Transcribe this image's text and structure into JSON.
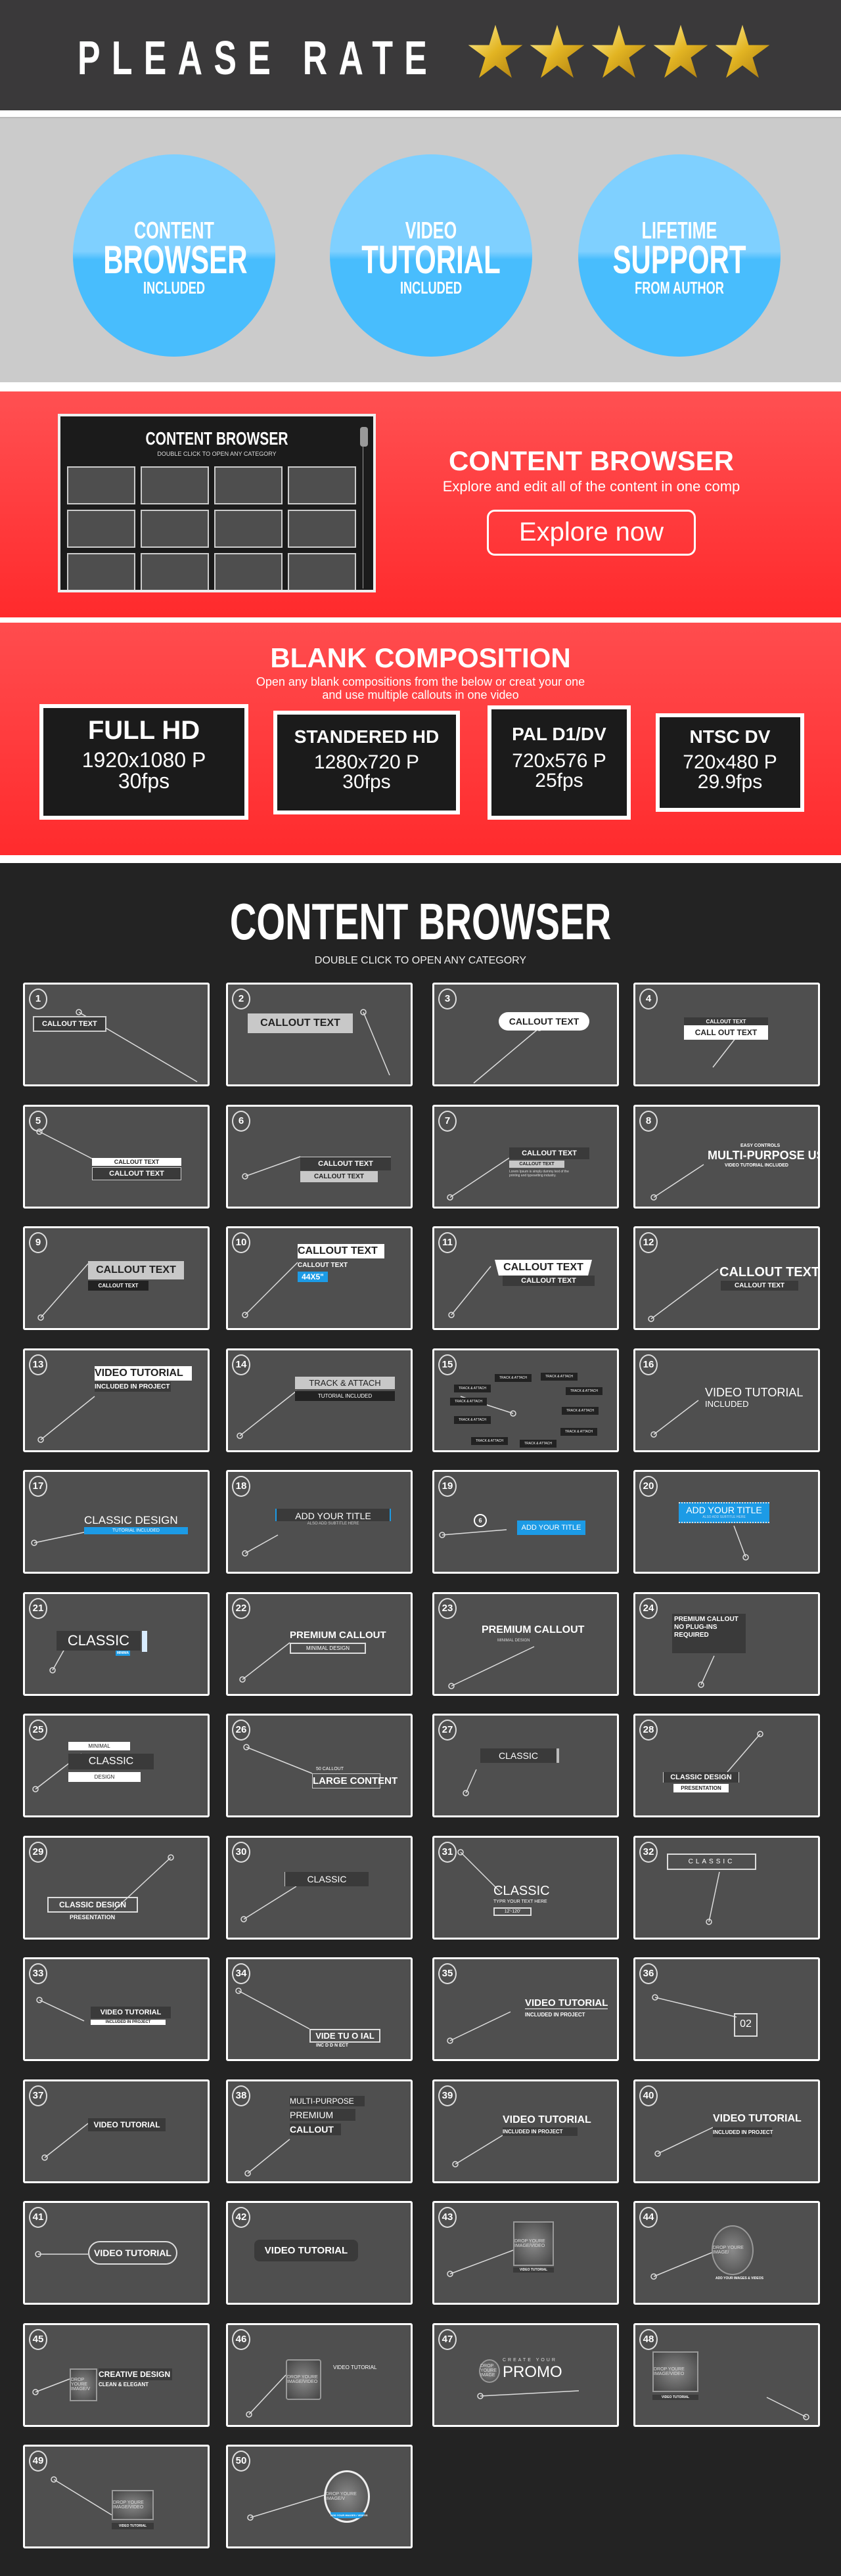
{
  "header": {
    "title": "PLEASE RATE",
    "rating": {
      "value": 5,
      "max": 5
    }
  },
  "features": [
    {
      "l1": "CONTENT",
      "l2": "BROWSER",
      "l3": "INCLUDED"
    },
    {
      "l1": "VIDEO",
      "l2": "TUTORIAL",
      "l3": "INCLUDED"
    },
    {
      "l1": "LIFETIME",
      "l2": "SUPPORT",
      "l3": "FROM AUTHOR"
    }
  ],
  "content_browser_promo": {
    "screenshot_title": "CONTENT BROWSER",
    "screenshot_subtitle": "DOUBLE CLICK TO OPEN  ANY CATEGORY",
    "title": "CONTENT BROWSER",
    "subtitle": "Explore and edit all of the content in one comp",
    "button": "Explore now"
  },
  "blank_composition": {
    "title": "BLANK COMPOSITION",
    "subtitle_line1": "Open any blank compositions from the below or creat your one",
    "subtitle_line2": "and use multiple callouts in one video",
    "presets": [
      {
        "name": "FULL HD",
        "resolution": "1920x1080 P",
        "fps": "30fps"
      },
      {
        "name": "STANDERED HD",
        "resolution": "1280x720 P",
        "fps": "30fps"
      },
      {
        "name": "PAL D1/DV",
        "resolution": "720x576 P",
        "fps": "25fps"
      },
      {
        "name": "NTSC DV",
        "resolution": "720x480 P",
        "fps": "29.9fps"
      }
    ]
  },
  "content_browser": {
    "title": "CONTENT BROWSER",
    "subtitle": "DOUBLE CLICK TO OPEN  ANY CATEGORY",
    "tiles": [
      {
        "n": "1",
        "texts": [
          "CALLOUT TEXT"
        ]
      },
      {
        "n": "2",
        "texts": [
          "CALLOUT TEXT"
        ]
      },
      {
        "n": "3",
        "texts": [
          "CALLOUT TEXT"
        ]
      },
      {
        "n": "4",
        "texts": [
          "CALLOUT TEXT",
          "CALL OUT TEXT"
        ]
      },
      {
        "n": "5",
        "texts": [
          "CALLOUT TEXT",
          "CALLOUT TEXT"
        ]
      },
      {
        "n": "6",
        "texts": [
          "CALLOUT TEXT",
          "CALLOUT TEXT"
        ]
      },
      {
        "n": "7",
        "texts": [
          "CALLOUT TEXT",
          "CALLOUT TEXT",
          "Lorem Ipsum is simply dummy text of the printing and typesetting industry."
        ]
      },
      {
        "n": "8",
        "texts": [
          "EASY CONTROLS",
          "MULTI-PURPOSE USE",
          "VIDEO TUTORIAL INCLUDED"
        ]
      },
      {
        "n": "9",
        "texts": [
          "CALLOUT TEXT",
          "CALLOUT TEXT"
        ]
      },
      {
        "n": "10",
        "texts": [
          "CALLOUT TEXT",
          "CALLOUT TEXT",
          "44X5\""
        ]
      },
      {
        "n": "11",
        "texts": [
          "CALLOUT TEXT",
          "CALLOUT TEXT"
        ]
      },
      {
        "n": "12",
        "texts": [
          "CALLOUT TEXT",
          "CALLOUT TEXT"
        ]
      },
      {
        "n": "13",
        "texts": [
          "VIDEO TUTORIAL",
          "INCLUDED IN PROJECT"
        ]
      },
      {
        "n": "14",
        "texts": [
          "TRACK & ATTACH",
          "TUTORIAL INCLUDED"
        ]
      },
      {
        "n": "15",
        "texts": [
          "TRACK & ATTACH"
        ]
      },
      {
        "n": "16",
        "texts": [
          "VIDEO TUTORIAL",
          "INCLUDED"
        ]
      },
      {
        "n": "17",
        "texts": [
          "CLASSIC DESIGN",
          "TUTORIAL INCLUDED"
        ]
      },
      {
        "n": "18",
        "texts": [
          "ADD YOUR TITLE",
          "ALSO ADD SUBTITLE HERE"
        ]
      },
      {
        "n": "19",
        "texts": [
          "ADD YOUR TITLE",
          "6"
        ]
      },
      {
        "n": "20",
        "texts": [
          "ADD YOUR TITLE",
          "ALSO ADD SUBTITLE HERE"
        ]
      },
      {
        "n": "21",
        "texts": [
          "CLASSIC",
          "MINIMA"
        ]
      },
      {
        "n": "22",
        "texts": [
          "PREMIUM CALLOUT",
          "MINIMAL DESIGN"
        ]
      },
      {
        "n": "23",
        "texts": [
          "PREMIUM CALLOUT",
          "MINIMAL DESIGN"
        ]
      },
      {
        "n": "24",
        "texts": [
          "PREMIUM CALLOUT",
          "NO PLUG-INS",
          "REQUIRED"
        ]
      },
      {
        "n": "25",
        "texts": [
          "MINIMAL",
          "CLASSIC",
          "DESIGN"
        ]
      },
      {
        "n": "26",
        "texts": [
          "50 CALLOUT",
          "LARGE CONTENT"
        ]
      },
      {
        "n": "27",
        "texts": [
          "CLASSIC"
        ]
      },
      {
        "n": "28",
        "texts": [
          "CLASSIC DESIGN",
          "PRESENTATION"
        ]
      },
      {
        "n": "29",
        "texts": [
          "CLASSIC DESIGN",
          "PRESENTATION"
        ]
      },
      {
        "n": "30",
        "texts": [
          "CLASSIC"
        ]
      },
      {
        "n": "31",
        "texts": [
          "CLASSIC",
          "TYPR YOUR TEXT HERE",
          "12'-120'"
        ]
      },
      {
        "n": "32",
        "texts": [
          "CLASSIC"
        ]
      },
      {
        "n": "33",
        "texts": [
          "VIDEO TUTORIAL",
          "INCLUDED IN PROJECT"
        ]
      },
      {
        "n": "34",
        "texts": [
          "VIDE  TU O IAL",
          "INC  D D N      ECT"
        ]
      },
      {
        "n": "35",
        "texts": [
          "VIDEO TUTORIAL",
          "INCLUDED IN PROJECT"
        ]
      },
      {
        "n": "36",
        "texts": [
          "02"
        ]
      },
      {
        "n": "37",
        "texts": [
          "VIDEO TUTORIAL"
        ]
      },
      {
        "n": "38",
        "texts": [
          "MULTI-PURPOSE",
          "PREMIUM",
          "CALLOUT"
        ]
      },
      {
        "n": "39",
        "texts": [
          "VIDEO TUTORIAL",
          "INCLUDED IN PROJECT"
        ]
      },
      {
        "n": "40",
        "texts": [
          "VIDEO TUTORIAL",
          "INCLUDED IN PROJECT"
        ]
      },
      {
        "n": "41",
        "texts": [
          "VIDEO TUTORIAL"
        ]
      },
      {
        "n": "42",
        "texts": [
          "VIDEO TUTORIAL"
        ]
      },
      {
        "n": "43",
        "texts": [
          "DROP YOURE IMAGE/VIDEO",
          "VIDEO TUTORIAL"
        ]
      },
      {
        "n": "44",
        "texts": [
          "DROP YOURE IMAGE/",
          "ADD YOUR IMAGES & VIDEOS"
        ]
      },
      {
        "n": "45",
        "texts": [
          "DROP YOURE IMAGE/V",
          "CREATIVE DESIGN",
          "CLEAN & ELEGANT"
        ]
      },
      {
        "n": "46",
        "texts": [
          "DROP YOURE IMAGE/VIDEO",
          "VIDEO TUTORIAL"
        ]
      },
      {
        "n": "47",
        "texts": [
          "DROP YOURE IMAGE",
          "CREATE YOUR",
          "PROMO"
        ]
      },
      {
        "n": "48",
        "texts": [
          "DROP YOURE IMAGE/VIDEO",
          "VIDEO TUTORIAL"
        ]
      },
      {
        "n": "49",
        "texts": [
          "DROP YOURE IMAGE/VIDEO",
          "VIDEO TUTORIAL"
        ]
      },
      {
        "n": "50",
        "texts": [
          "DROP YOURE IMAGE/V",
          "ADD YOUR IMAGES / VIDEOS"
        ]
      }
    ]
  },
  "colors": {
    "header_bg": "#3a393a",
    "red": "#ff3a3c",
    "blue": "#48bdfd",
    "accent_blue": "#1c9be6",
    "dark": "#232323",
    "tile": "#4f4f4f",
    "star": "#e8c22a"
  }
}
